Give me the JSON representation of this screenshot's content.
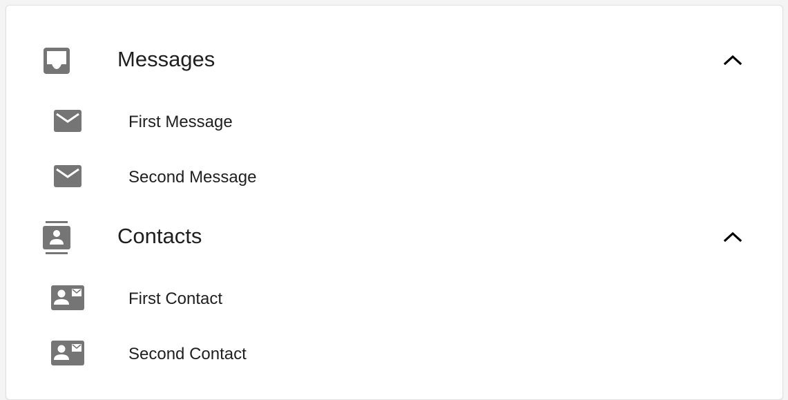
{
  "sections": [
    {
      "title": "Messages",
      "icon": "inbox-icon",
      "expanded": true,
      "items": [
        {
          "label": "First Message",
          "icon": "mail-icon"
        },
        {
          "label": "Second Message",
          "icon": "mail-icon"
        }
      ]
    },
    {
      "title": "Contacts",
      "icon": "contacts-icon",
      "expanded": true,
      "items": [
        {
          "label": "First Contact",
          "icon": "contact-mail-icon"
        },
        {
          "label": "Second Contact",
          "icon": "contact-mail-icon"
        }
      ]
    }
  ],
  "colors": {
    "icon": "#757575",
    "text": "#1f1f1f",
    "chevron": "#000000"
  }
}
